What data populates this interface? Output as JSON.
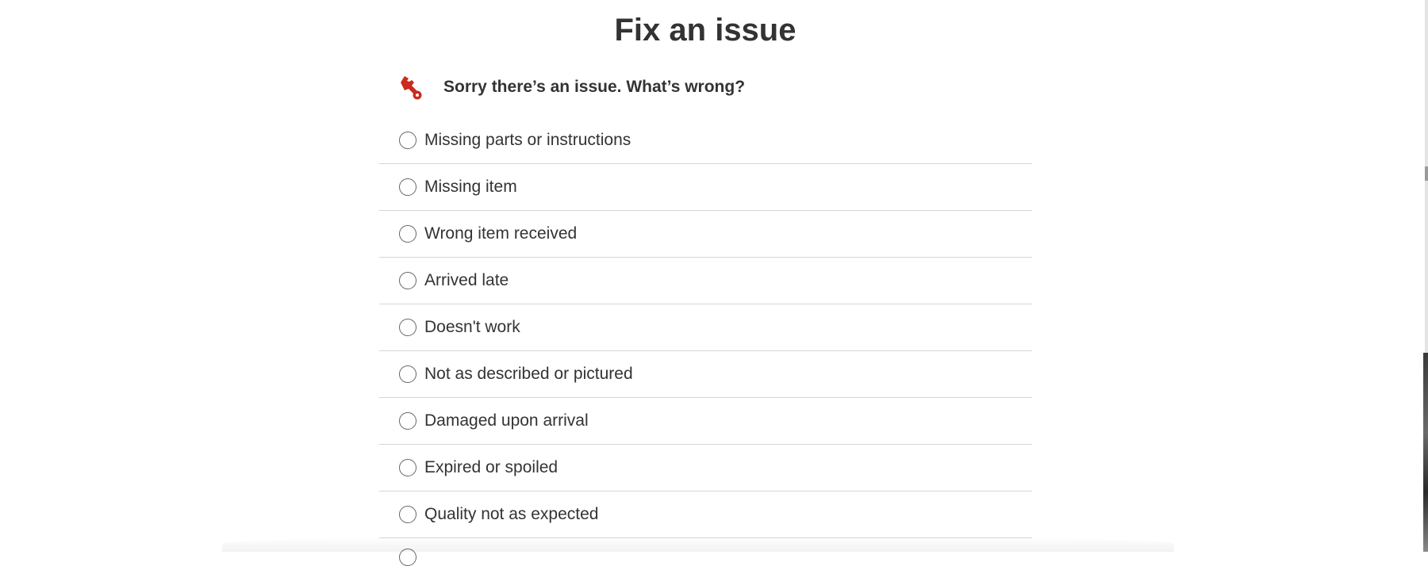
{
  "page": {
    "title": "Fix an issue",
    "prompt": "Sorry there’s an issue. What’s wrong?",
    "prompt_icon": "wrench-icon",
    "accent_color": "#cc2a1e"
  },
  "issue_options": [
    {
      "label": "Missing parts or instructions",
      "selected": false
    },
    {
      "label": "Missing item",
      "selected": false
    },
    {
      "label": "Wrong item received",
      "selected": false
    },
    {
      "label": "Arrived late",
      "selected": false
    },
    {
      "label": "Doesn't work",
      "selected": false
    },
    {
      "label": "Not as described or pictured",
      "selected": false
    },
    {
      "label": "Damaged upon arrival",
      "selected": false
    },
    {
      "label": "Expired or spoiled",
      "selected": false
    },
    {
      "label": "Quality not as expected",
      "selected": false
    }
  ]
}
